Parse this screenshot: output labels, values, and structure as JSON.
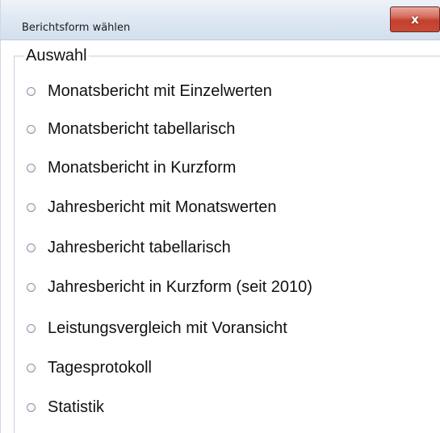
{
  "window": {
    "title": "Berichtsform wählen",
    "close_symbol": "x"
  },
  "group": {
    "label": "Auswahl"
  },
  "options": [
    {
      "label": "Monatsbericht mit Einzelwerten",
      "selected": false
    },
    {
      "label": "Monatsbericht tabellarisch",
      "selected": false
    },
    {
      "label": "Monatsbericht in Kurzform",
      "selected": false
    },
    {
      "label": "Jahresbericht mit Monatswerten",
      "selected": false
    },
    {
      "label": "Jahresbericht tabellarisch",
      "selected": false
    },
    {
      "label": "Jahresbericht in Kurzform (seit 2010)",
      "selected": false
    },
    {
      "label": "Leistungsvergleich mit Voransicht",
      "selected": false
    },
    {
      "label": "Tagesprotokoll",
      "selected": false
    },
    {
      "label": "Statistik",
      "selected": false
    }
  ]
}
